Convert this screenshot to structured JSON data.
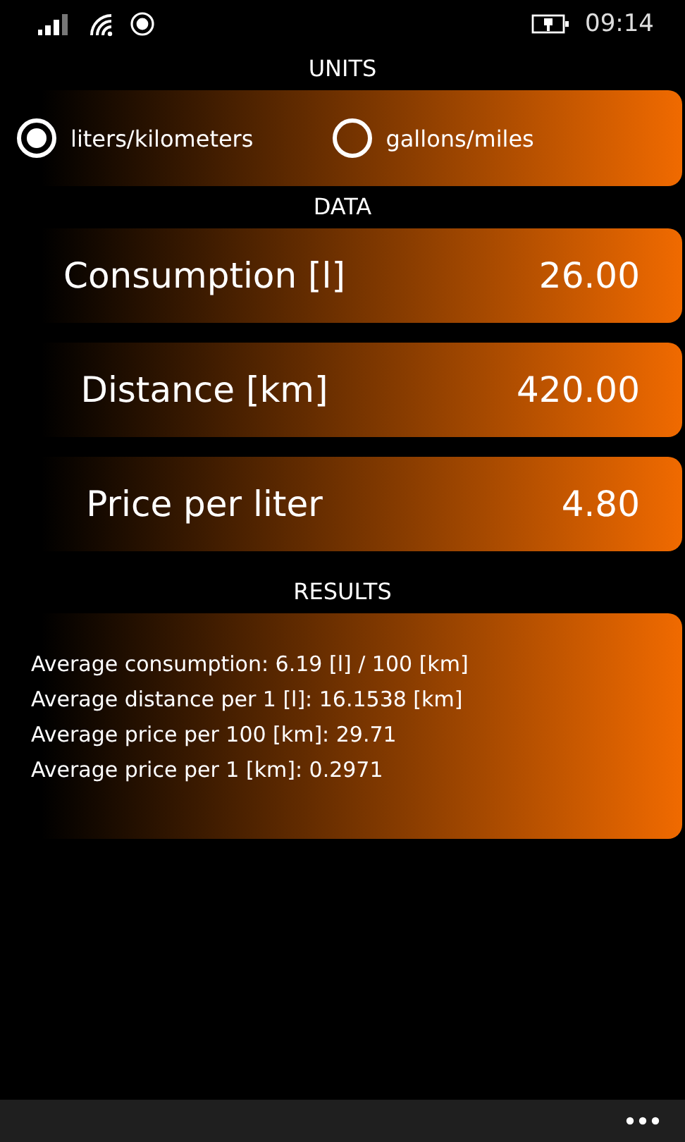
{
  "status_bar": {
    "time": "09:14"
  },
  "units": {
    "title": "UNITS",
    "options": [
      {
        "label": "liters/kilometers",
        "selected": true
      },
      {
        "label": "gallons/miles",
        "selected": false
      }
    ]
  },
  "data": {
    "title": "DATA",
    "fields": [
      {
        "label": "Consumption [l]",
        "value": "26.00"
      },
      {
        "label": "Distance [km]",
        "value": "420.00"
      },
      {
        "label": "Price per liter",
        "value": "4.80"
      }
    ]
  },
  "results": {
    "title": "RESULTS",
    "lines": [
      "Average consumption: 6.19 [l] / 100 [km]",
      "Average distance per 1 [l]: 16.1538 [km]",
      "Average price per 100 [km]: 29.71",
      "Average price per 1 [km]: 0.2971"
    ]
  }
}
